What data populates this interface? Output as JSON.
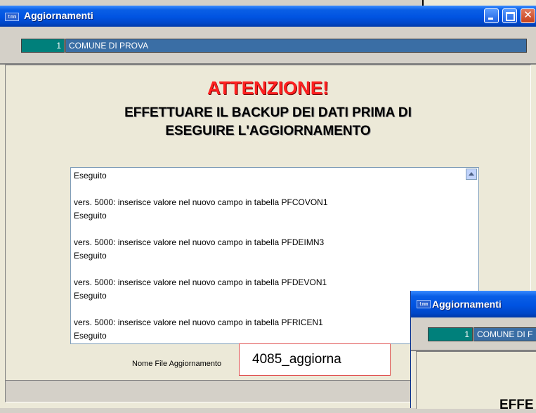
{
  "main_window": {
    "title": "Aggiornamenti",
    "app_icon": "app-icon",
    "app_icon_text": "tmm",
    "controls": {
      "minimize": "minimize-icon",
      "maximize": "maximize-icon",
      "close": "close-icon"
    },
    "entity_code": "1",
    "entity_name": "COMUNE DI PROVA",
    "attention_title": "ATTENZIONE!",
    "warning_line1": "EFFETTUARE IL BACKUP DEI DATI PRIMA DI",
    "warning_line2": "ESEGUIRE L'AGGIORNAMENTO",
    "log_lines": [
      "Eseguito",
      "",
      "vers. 5000: inserisce valore nel nuovo campo in tabella PFCOVON1",
      "Eseguito",
      "",
      "vers. 5000: inserisce valore nel nuovo campo in tabella PFDEIMN3",
      "Eseguito",
      "",
      "vers. 5000: inserisce valore nel nuovo campo in tabella PFDEVON1",
      "Eseguito",
      "",
      "vers. 5000: inserisce valore nel nuovo campo in tabella PFRICEN1",
      "Eseguito"
    ],
    "file_label": "Nome File Aggiornamento",
    "file_value": "4085_aggiorna"
  },
  "second_window": {
    "title": "Aggiornamenti",
    "entity_code": "1",
    "entity_name": "COMUNE DI F",
    "partial_text": "EFFE"
  },
  "colors": {
    "titlebar": "#0053e1",
    "attention": "#ff2020",
    "code_box": "#00807b",
    "name_bar": "#3a6ea5",
    "window_bg": "#ece9d8"
  }
}
